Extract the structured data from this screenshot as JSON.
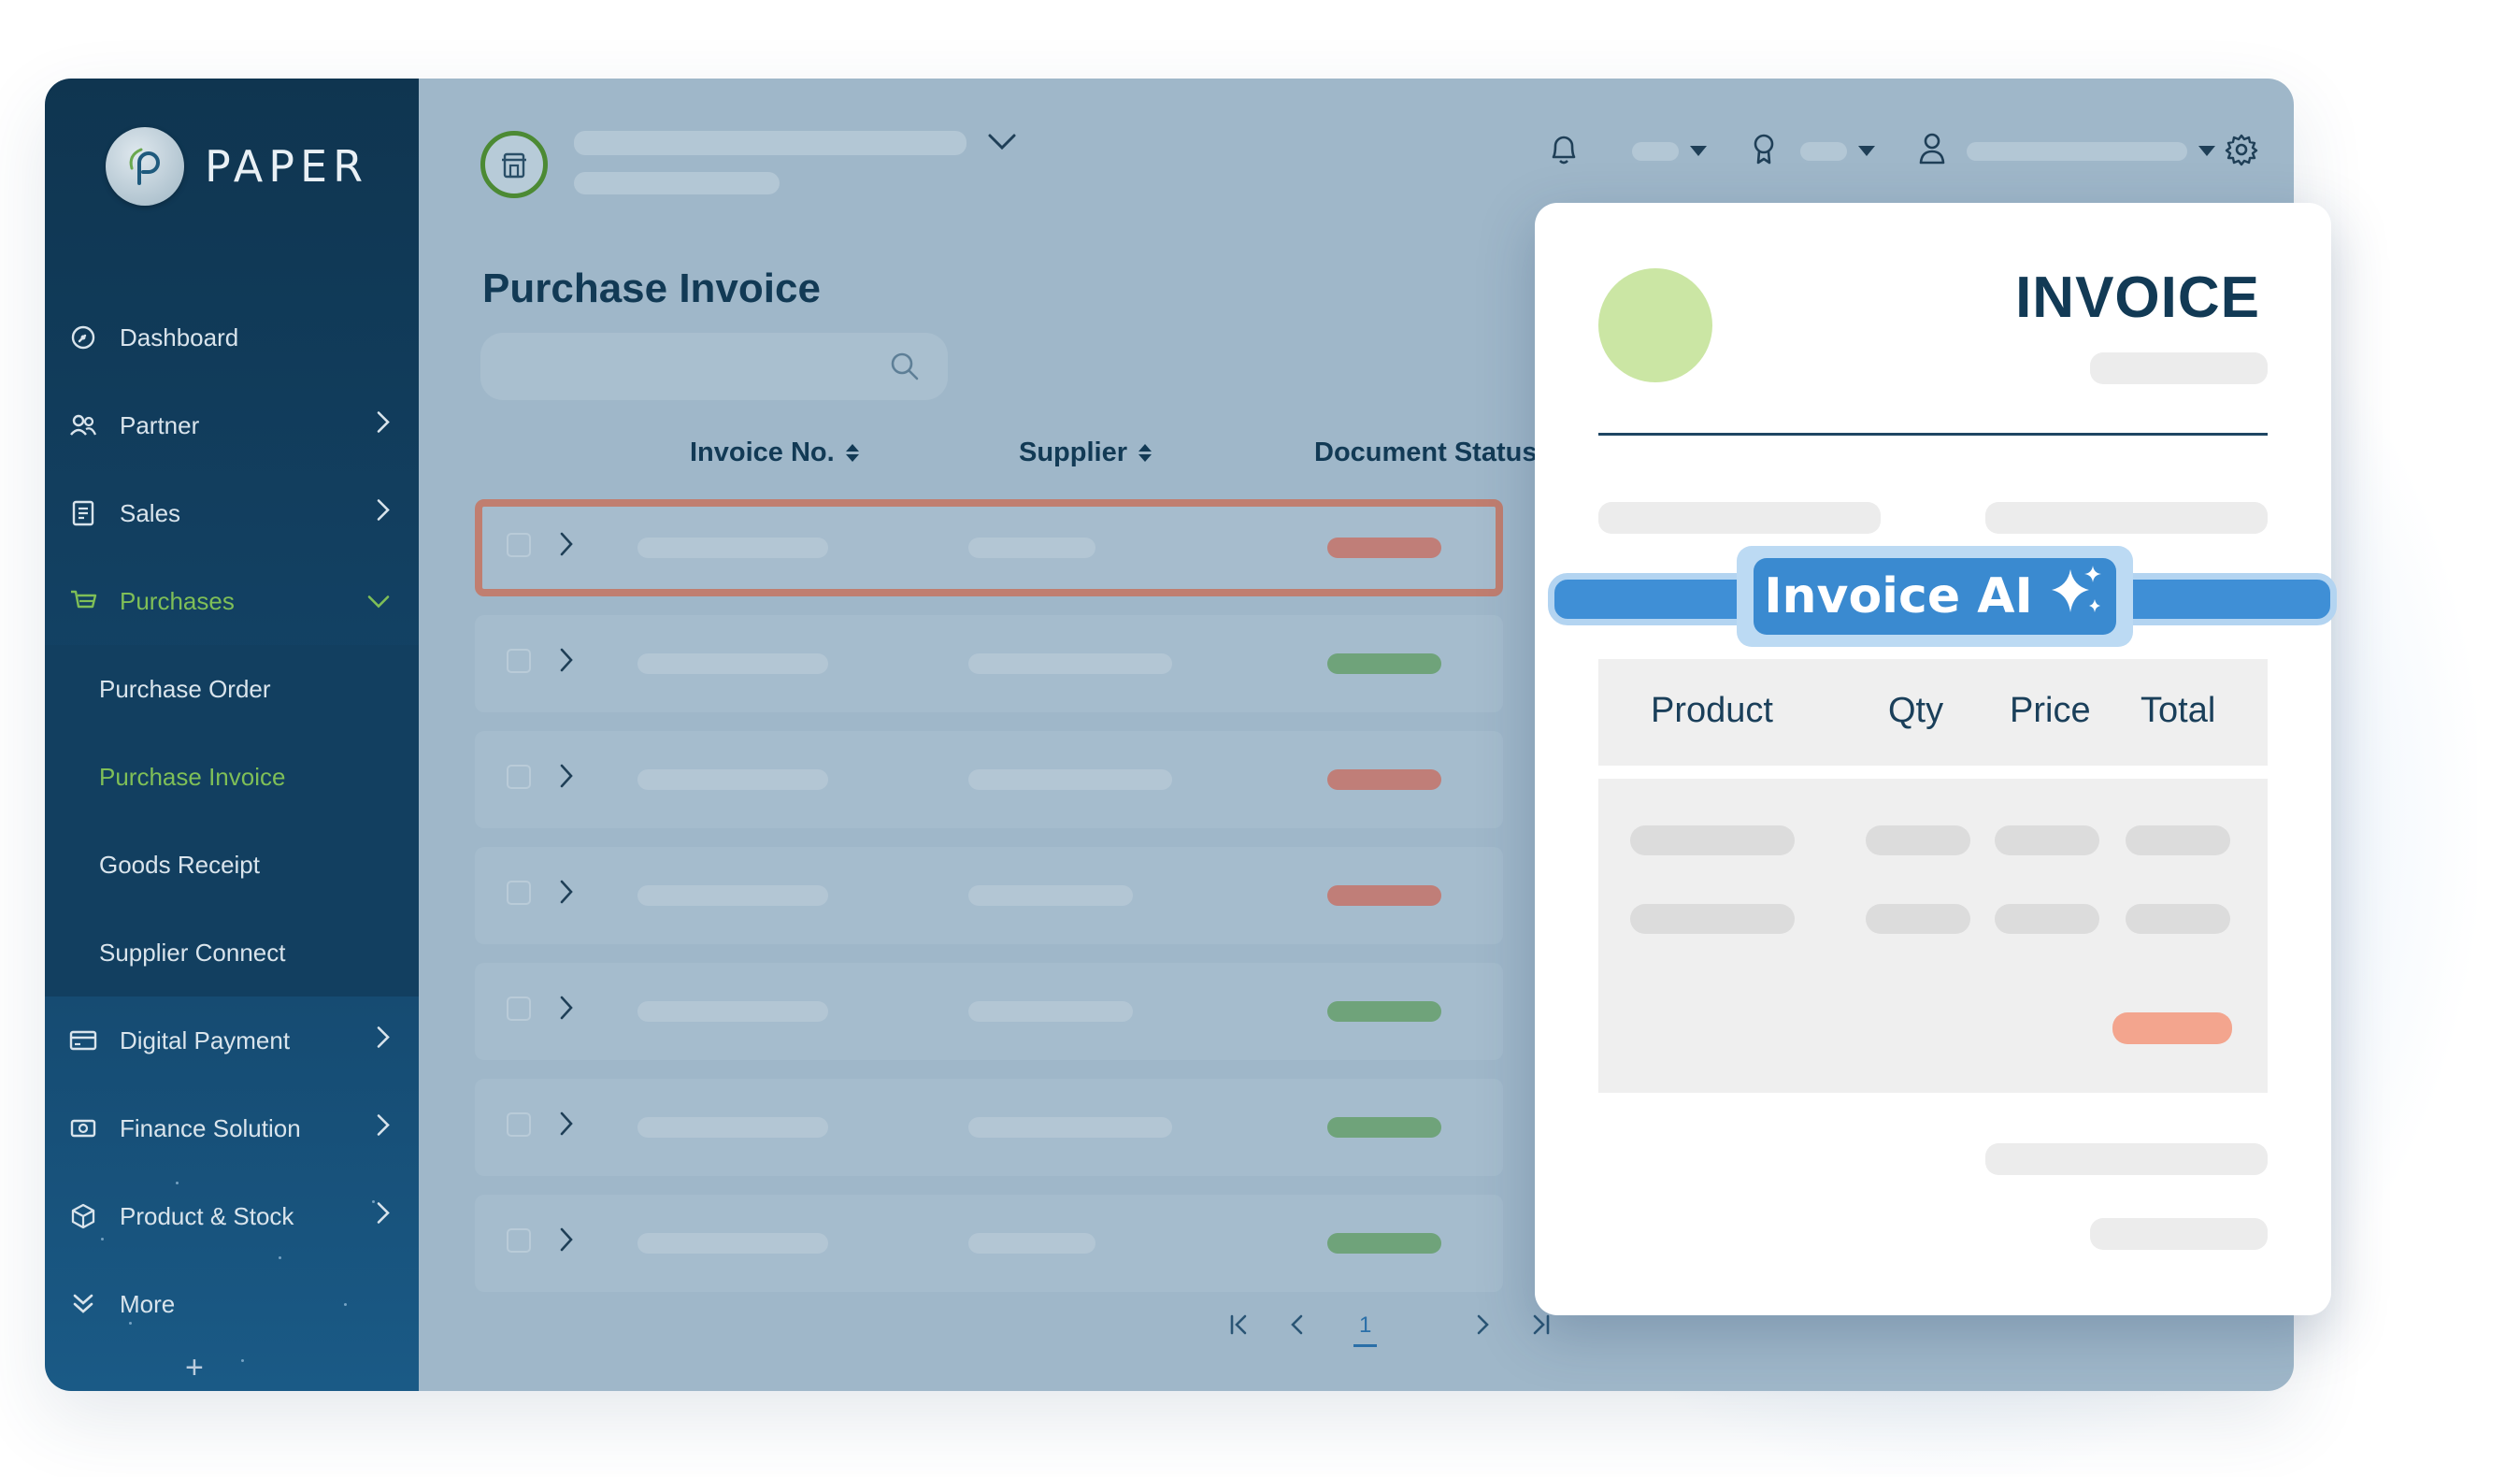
{
  "brand": {
    "name": "PAPER"
  },
  "sidebar": {
    "items": [
      {
        "label": "Dashboard",
        "icon": "dashboard-icon"
      },
      {
        "label": "Partner",
        "icon": "partner-icon"
      },
      {
        "label": "Sales",
        "icon": "sales-icon"
      },
      {
        "label": "Purchases",
        "icon": "purchases-icon",
        "expanded": true
      },
      {
        "label": "Digital Payment",
        "icon": "digital-payment-icon"
      },
      {
        "label": "Finance Solution",
        "icon": "finance-icon"
      },
      {
        "label": "Product & Stock",
        "icon": "product-icon"
      },
      {
        "label": "More",
        "icon": "more-icon"
      }
    ],
    "purchases_sub": [
      {
        "label": "Purchase Order"
      },
      {
        "label": "Purchase Invoice",
        "active": true
      },
      {
        "label": "Goods Receipt"
      },
      {
        "label": "Supplier Connect"
      }
    ],
    "active_color": "#7fbf57"
  },
  "main": {
    "page_title": "Purchase Invoice",
    "columns": [
      "Invoice No.",
      "Supplier",
      "Document Status"
    ],
    "rows": [
      {
        "status_color": "#c07e78",
        "highlighted": true
      },
      {
        "status_color": "#6fa37a"
      },
      {
        "status_color": "#c07e78"
      },
      {
        "status_color": "#c07e78"
      },
      {
        "status_color": "#6fa37a"
      },
      {
        "status_color": "#6fa37a"
      },
      {
        "status_color": "#6fa37a"
      }
    ],
    "pagination": {
      "current_page": "1"
    }
  },
  "invoice_card": {
    "title": "INVOICE",
    "table_headers": [
      "Product",
      "Qty",
      "Price",
      "Total"
    ],
    "total_color": "#f3a58e"
  },
  "ai_badge": {
    "label": "Invoice AI",
    "sparkle": "✨"
  }
}
